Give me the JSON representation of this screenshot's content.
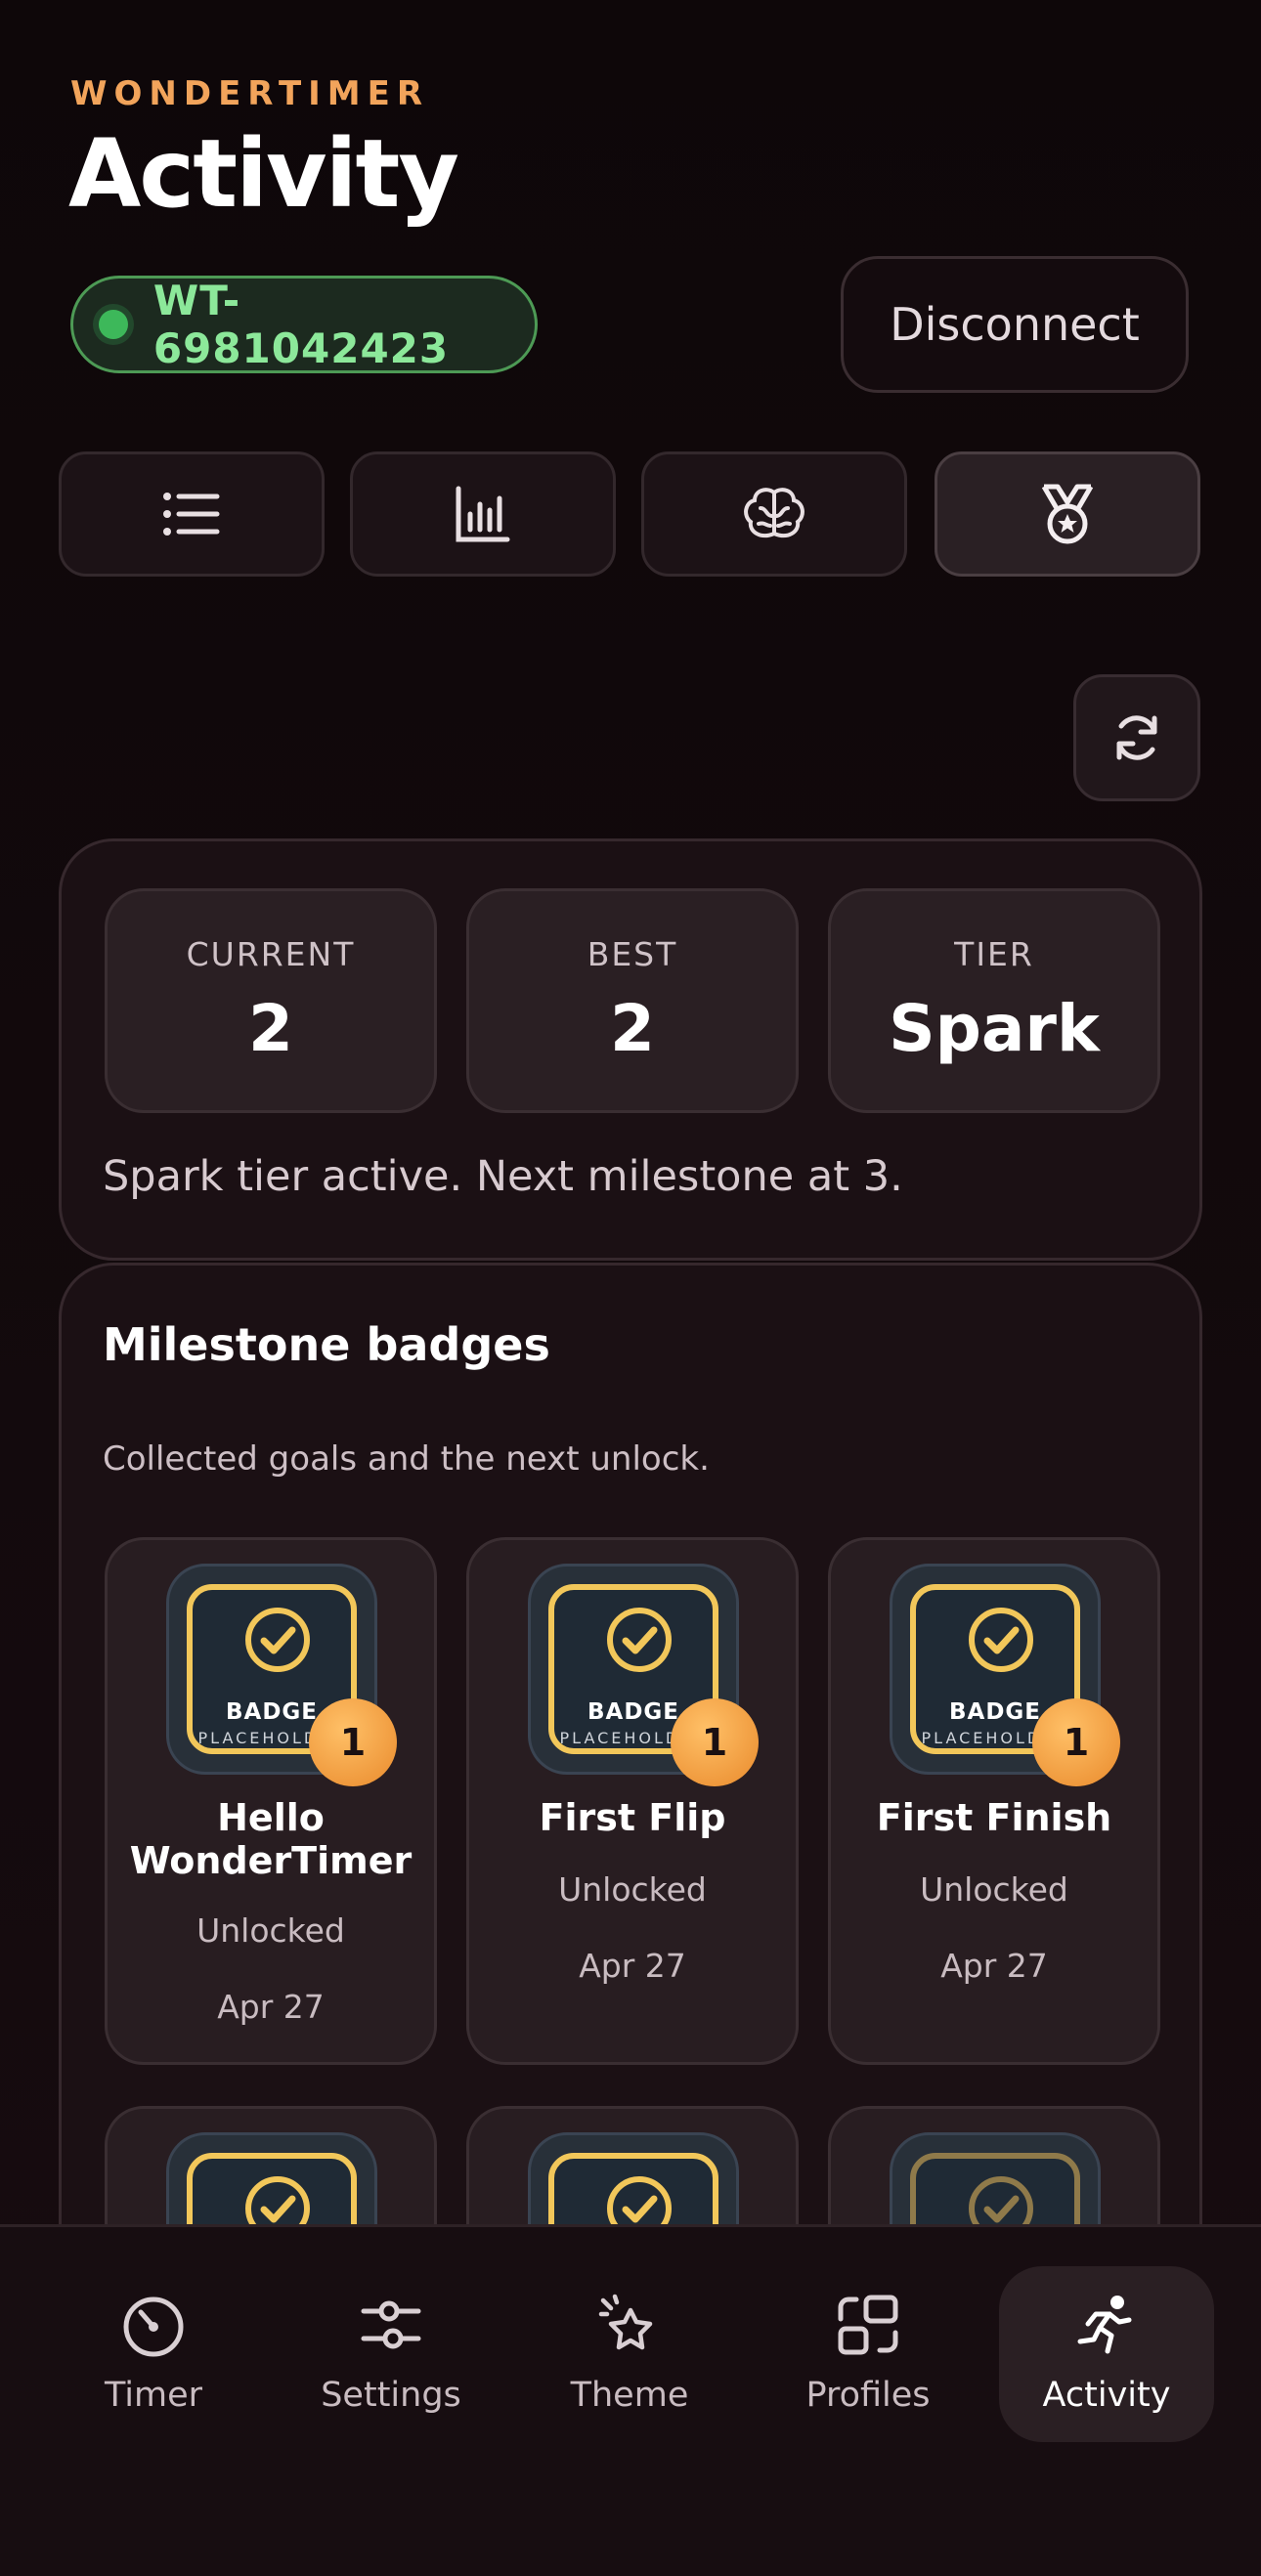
{
  "header": {
    "brand": "WONDERTIMER",
    "title": "Activity",
    "device_id": "WT-6981042423",
    "disconnect_label": "Disconnect"
  },
  "segments": [
    {
      "icon": "list-icon",
      "active": false
    },
    {
      "icon": "bar-chart-icon",
      "active": false
    },
    {
      "icon": "brain-icon",
      "active": false
    },
    {
      "icon": "medal-icon",
      "active": true
    }
  ],
  "streak": {
    "current_label": "CURRENT",
    "current_value": "2",
    "best_label": "BEST",
    "best_value": "2",
    "tier_label": "TIER",
    "tier_value": "Spark",
    "message": "Spark tier active. Next milestone at 3."
  },
  "badges": {
    "title": "Milestone badges",
    "subtitle": "Collected goals and the next unlock.",
    "placeholder_title": "BADGE",
    "placeholder_sub": "PLACEHOLDER",
    "items": [
      {
        "name": "Hello WonderTimer",
        "status": "Unlocked",
        "date": "Apr 27",
        "count": "1"
      },
      {
        "name": "First Flip",
        "status": "Unlocked",
        "date": "Apr 27",
        "count": "1"
      },
      {
        "name": "First Finish",
        "status": "Unlocked",
        "date": "Apr 27",
        "count": "1"
      }
    ]
  },
  "tabbar": {
    "items": [
      {
        "label": "Timer",
        "icon": "timer-icon"
      },
      {
        "label": "Settings",
        "icon": "sliders-icon"
      },
      {
        "label": "Theme",
        "icon": "sparkle-icon"
      },
      {
        "label": "Profiles",
        "icon": "profiles-icon"
      },
      {
        "label": "Activity",
        "icon": "running-person-icon",
        "active": true
      }
    ]
  },
  "colors": {
    "accent": "#f2a45b",
    "connected": "#8ce89a",
    "badge_gold": "#f2c75a",
    "count_orange": "#f29a3a"
  }
}
